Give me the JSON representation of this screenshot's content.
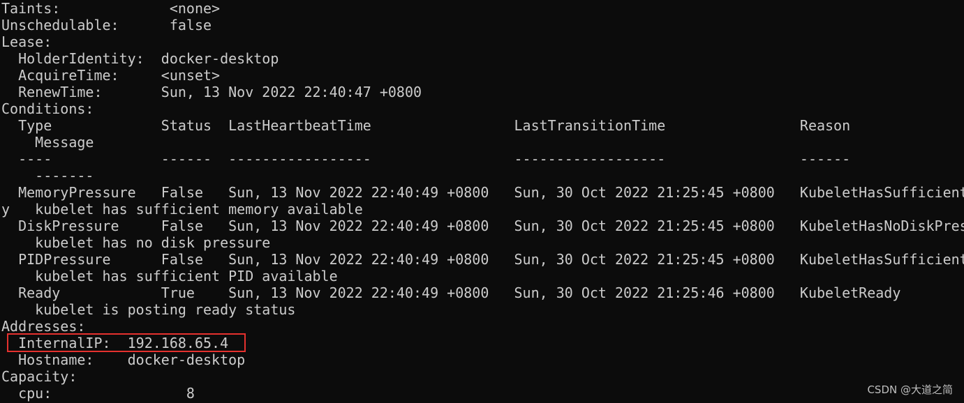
{
  "terminal": {
    "lines": [
      "Taints:             <none>",
      "Unschedulable:      false",
      "Lease:",
      "  HolderIdentity:  docker-desktop",
      "  AcquireTime:     <unset>",
      "  RenewTime:       Sun, 13 Nov 2022 22:40:47 +0800",
      "Conditions:",
      "  Type             Status  LastHeartbeatTime                 LastTransitionTime                Reason",
      "    Message",
      "  ----             ------  -----------------                 ------------------                ------",
      "    -------",
      "  MemoryPressure   False   Sun, 13 Nov 2022 22:40:49 +0800   Sun, 30 Oct 2022 21:25:45 +0800   KubeletHasSufficient",
      "y   kubelet has sufficient memory available",
      "  DiskPressure     False   Sun, 13 Nov 2022 22:40:49 +0800   Sun, 30 Oct 2022 21:25:45 +0800   KubeletHasNoDiskPres",
      "    kubelet has no disk pressure",
      "  PIDPressure      False   Sun, 13 Nov 2022 22:40:49 +0800   Sun, 30 Oct 2022 21:25:45 +0800   KubeletHasSufficient",
      "    kubelet has sufficient PID available",
      "  Ready            True    Sun, 13 Nov 2022 22:40:49 +0800   Sun, 30 Oct 2022 21:25:46 +0800   KubeletReady",
      "    kubelet is posting ready status",
      "Addresses:",
      "  InternalIP:  192.168.65.4",
      "  Hostname:    docker-desktop",
      "Capacity:",
      "  cpu:                8"
    ]
  },
  "watermark": "CSDN @大道之简",
  "colors": {
    "background": "#0c0c0c",
    "text": "#cccccc",
    "highlight_border": "#e5312e"
  }
}
